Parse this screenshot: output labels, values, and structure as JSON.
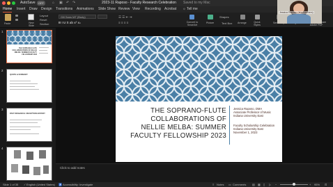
{
  "titlebar": {
    "autosave_label": "AutoSave",
    "autosave_state": "OFF",
    "document_title": "2023-11 Raposo - Faculty Research Celebration",
    "save_status": "Saved to my Mac"
  },
  "tabs": [
    {
      "label": "Home",
      "active": true
    },
    {
      "label": "Insert",
      "active": false
    },
    {
      "label": "Draw",
      "active": false
    },
    {
      "label": "Design",
      "active": false
    },
    {
      "label": "Transitions",
      "active": false
    },
    {
      "label": "Animations",
      "active": false
    },
    {
      "label": "Slide Show",
      "active": false
    },
    {
      "label": "Review",
      "active": false
    },
    {
      "label": "View",
      "active": false
    },
    {
      "label": "Recording",
      "active": false
    },
    {
      "label": "Acrobat",
      "active": false
    },
    {
      "label": "Tell me",
      "active": false
    }
  ],
  "ribbon": {
    "paste_label": "Paste",
    "new_slide_label": "New Slide",
    "layout_label": "Layout",
    "reset_label": "Reset",
    "section_label": "Section",
    "font_name": "Gill Sans MT (Body)",
    "font_size": "",
    "convert_smartart_label": "Convert to SmartArt",
    "picture_label": "Picture",
    "shapes_label": "Shapes",
    "text_box_label": "Text Box",
    "arrange_label": "Arrange",
    "quick_styles_label": "Quick Styles",
    "sensitivity_label": "Sensitivity",
    "designer_label": "Designer",
    "create_share_label": "Create and Share Adobe PDF"
  },
  "webcam": {
    "name_caption": "Jessica Raposo (she/her/hers)"
  },
  "thumbnails": [
    {
      "number": "1",
      "title": "THE SOPRANO-FLUTE COLLABORATIONS OF NELLIE MELBA: SUMMER FACULTY FELLOWSHIP 2023",
      "selected": true
    },
    {
      "number": "2",
      "title": "QUOTE & SUMMARY",
      "selected": false
    },
    {
      "number": "3",
      "title": "PAST RESEARCH: RECEPTION HISTORY",
      "selected": false
    },
    {
      "number": "4",
      "title": "",
      "selected": false
    }
  ],
  "slide": {
    "title": "THE SOPRANO-FLUTE COLLABORATIONS OF NELLIE MELBA: SUMMER FACULTY FELLOWSHIP 2023",
    "presenter_lines": [
      "Jessica Raposo, DMA",
      "Associate Professor of Music",
      "Indiana University East"
    ],
    "event_lines": [
      "Faculty Scholarship Celebration",
      "Indiana University East",
      "November 1, 2023"
    ],
    "pattern_color": "#4a7fa6"
  },
  "notes": {
    "placeholder": "Click to add notes"
  },
  "status": {
    "slide_counter": "Slide 1 of 35",
    "language": "English (United States)",
    "accessibility": "Accessibility: Investigate",
    "notes_button": "Notes",
    "comments_button": "Comments",
    "zoom": "95%"
  }
}
